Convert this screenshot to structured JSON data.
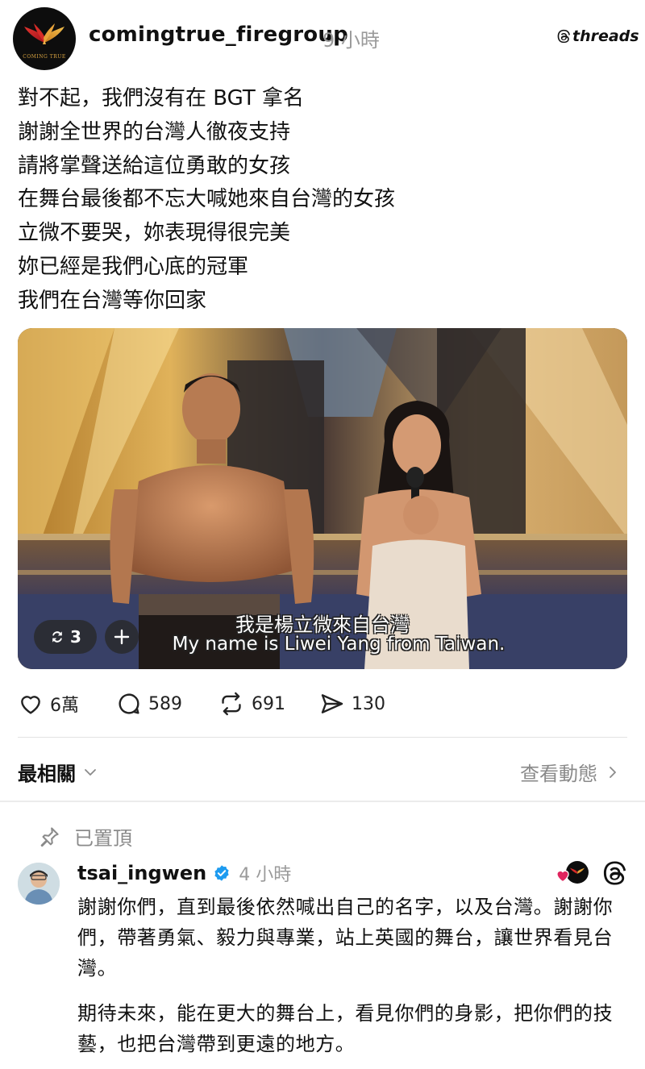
{
  "post": {
    "username": "comingtrue_firegroup",
    "time": "9 小時",
    "brand": "threads",
    "avatar_text": "COMING TRUE",
    "lines": [
      "對不起，我們沒有在 BGT 拿名",
      "謝謝全世界的台灣人徹夜支持",
      "請將掌聲送給這位勇敢的女孩",
      "在舞台最後都不忘大喊她來自台灣的女孩",
      "立微不要哭，妳表現得很完美",
      "妳已經是我們心底的冠軍",
      "我們在台灣等你回家"
    ],
    "video": {
      "repost_count": "3",
      "subtitle_zh": "我是楊立微來自台灣",
      "subtitle_en": "My name is Liwei Yang from Taiwan."
    },
    "actions": {
      "likes": "6萬",
      "comments": "589",
      "reposts": "691",
      "shares": "130"
    }
  },
  "replies_header": {
    "sort_label": "最相關",
    "activity_label": "查看動態"
  },
  "reply": {
    "pinned_label": "已置頂",
    "username": "tsai_ingwen",
    "time": "4 小時",
    "paragraph1": "謝謝你們，直到最後依然喊出自己的名字，以及台灣。謝謝你們，帶著勇氣、毅力與專業，站上英國的舞台，讓世界看見台灣。",
    "paragraph2": "期待未來，能在更大的舞台上，看見你們的身影，把你們的技藝，也把台灣帶到更遠的地方。"
  },
  "colors": {
    "verified": "#1d9bf0",
    "heart": "#e0245e",
    "muted": "#8a8a8a"
  }
}
